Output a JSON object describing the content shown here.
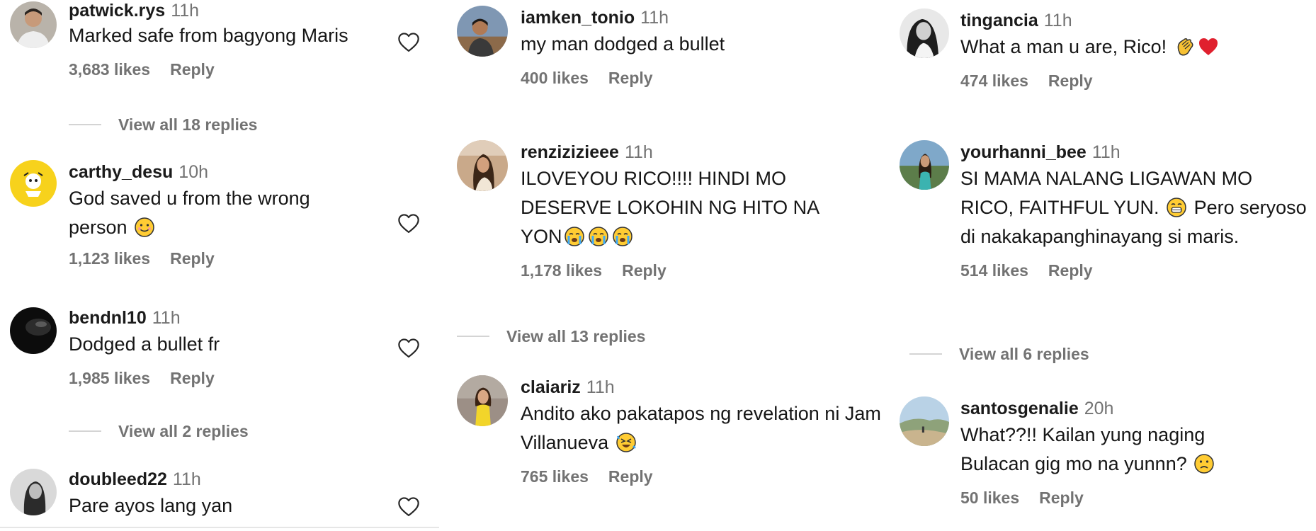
{
  "columns": [
    {
      "comments": [
        {
          "username": "patwick.rys",
          "time": "11h",
          "text": "Marked safe from bagyong Maris",
          "likes": "3,683 likes",
          "reply": "Reply",
          "view_replies": "View all 18 replies",
          "avatar": "avatar-man-white-shirt",
          "emoji": []
        },
        {
          "username": "carthy_desu",
          "time": "10h",
          "text": "God saved u from the wrong person",
          "likes": "1,123 likes",
          "reply": "Reply",
          "view_replies": "",
          "avatar": "avatar-yellow-cartoon",
          "emoji": [
            "smiling-face-emoji"
          ]
        },
        {
          "username": "bendnl10",
          "time": "11h",
          "text": "Dodged a bullet fr",
          "likes": "1,985 likes",
          "reply": "Reply",
          "view_replies": "View all 2 replies",
          "avatar": "avatar-dark",
          "emoji": []
        },
        {
          "username": "doubleed22",
          "time": "11h",
          "text": "Pare ayos lang yan",
          "likes": "",
          "reply": "",
          "view_replies": "",
          "avatar": "avatar-grey-portrait",
          "emoji": []
        }
      ]
    },
    {
      "comments": [
        {
          "username": "iamken_tonio",
          "time": "11h",
          "text": "my man dodged a bullet",
          "likes": "400 likes",
          "reply": "Reply",
          "view_replies": "",
          "avatar": "avatar-man-outdoor",
          "emoji": []
        },
        {
          "username": "renzizizieee",
          "time": "11h",
          "text": "ILOVEYOU RICO!!!! HINDI MO DESERVE LOKOHIN NG HITO NA YON",
          "likes": "1,178 likes",
          "reply": "Reply",
          "view_replies": "View all 13 replies",
          "avatar": "avatar-woman-warm",
          "emoji": [
            "crying-face-emoji",
            "crying-face-emoji",
            "crying-face-emoji"
          ]
        },
        {
          "username": "claiariz",
          "time": "11h",
          "text": "Andito ako pakatapos ng revelation ni Jam Villanueva",
          "likes": "765 likes",
          "reply": "Reply",
          "view_replies": "",
          "avatar": "avatar-woman-yellow",
          "emoji": [
            "rolling-laughing-emoji"
          ]
        }
      ]
    },
    {
      "comments": [
        {
          "username": "tingancia",
          "time": "11h",
          "text": "What a man u are, Rico!",
          "likes": "474 likes",
          "reply": "Reply",
          "view_replies": "",
          "avatar": "avatar-woman-bw",
          "emoji": [
            "clapping-hands-emoji",
            "red-heart-emoji"
          ]
        },
        {
          "username": "yourhanni_bee",
          "time": "11h",
          "text": "SI MAMA NALANG LIGAWAN MO RICO, FAITHFUL YUN.",
          "text2": "Pero seryoso di nakakapanghinayang si maris.",
          "likes": "514 likes",
          "reply": "Reply",
          "view_replies": "View all 6 replies",
          "avatar": "avatar-woman-outdoor",
          "emoji": [
            "grinning-face-emoji"
          ]
        },
        {
          "username": "santosgenalie",
          "time": "20h",
          "text": "What??!! Kailan yung naging Bulacan gig mo na yunnn?",
          "likes": "50 likes",
          "reply": "Reply",
          "view_replies": "",
          "avatar": "avatar-landscape",
          "emoji": [
            "sad-face-emoji"
          ]
        }
      ]
    }
  ],
  "colors": {
    "muted": "#737373",
    "text": "#161616",
    "heart_outline": "#262626"
  }
}
